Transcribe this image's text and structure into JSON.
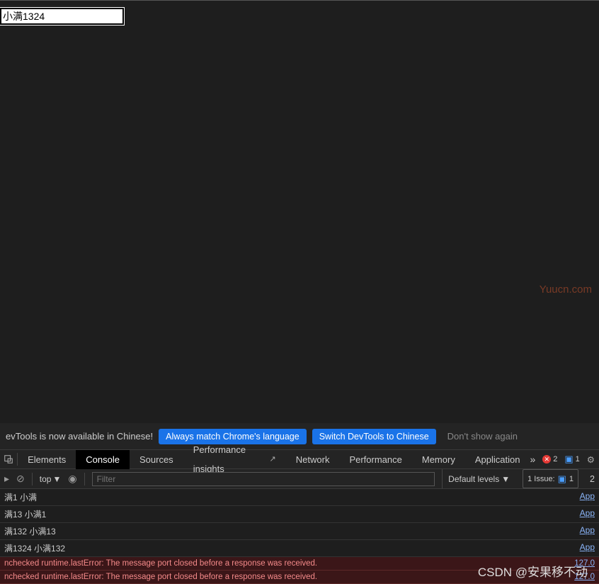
{
  "page": {
    "input_value": "小满1324"
  },
  "banner": {
    "text": "evTools is now available in Chinese!",
    "btn1": "Always match Chrome's language",
    "btn2": "Switch DevTools to Chinese",
    "btn3": "Don't show again"
  },
  "tabs": {
    "items": [
      "Elements",
      "Console",
      "Sources",
      "Performance insights",
      "Network",
      "Performance",
      "Memory",
      "Application"
    ],
    "active": "Console",
    "error_count": "2",
    "msg_count": "1"
  },
  "toolbox": {
    "context": "top",
    "filter_placeholder": "Filter",
    "levels": "Default levels",
    "issue_label": "1 Issue:",
    "issue_count": "1"
  },
  "logs": [
    {
      "text": "满1 小满",
      "src": "App"
    },
    {
      "text": "满13 小满1",
      "src": "App"
    },
    {
      "text": "满132 小满13",
      "src": "App"
    },
    {
      "text": "满1324 小满132",
      "src": "App"
    }
  ],
  "errors": [
    {
      "text": "nchecked runtime.lastError: The message port closed before a response was received.",
      "src": "127.0"
    },
    {
      "text": "nchecked runtime.lastError: The message port closed before a response was received.",
      "src": "127.0"
    }
  ],
  "watermark": "CSDN @安果移不动",
  "watermark2": "Yuucn.com"
}
